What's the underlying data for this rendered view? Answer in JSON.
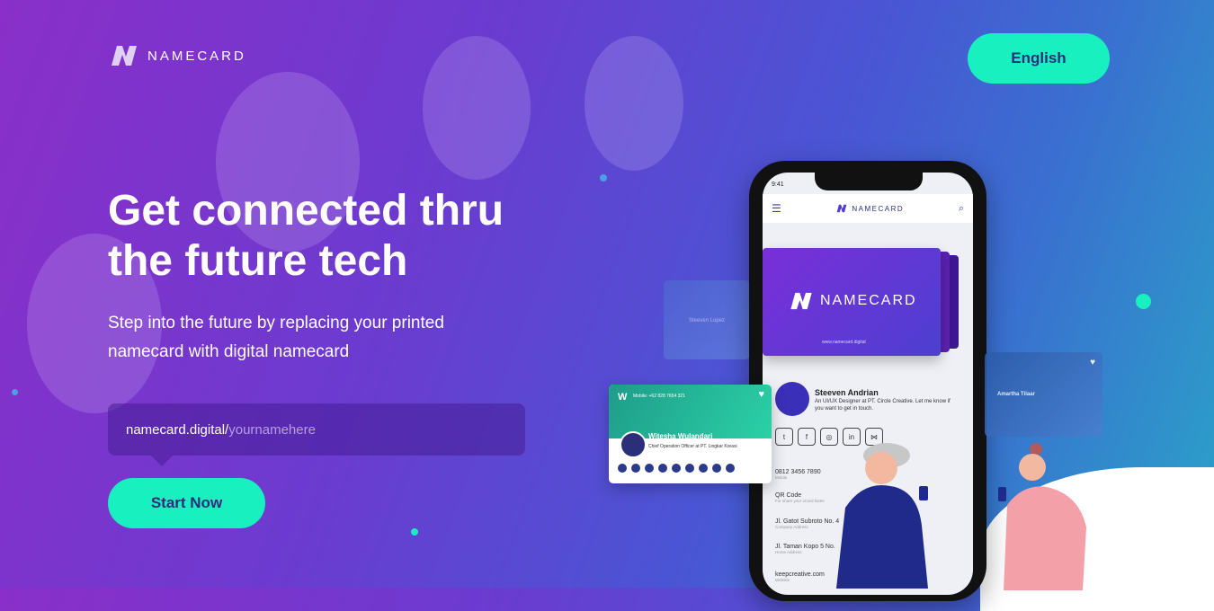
{
  "header": {
    "logo_text": "NAMECARD",
    "language_button": "English"
  },
  "hero": {
    "title": "Get connected thru the future tech",
    "subtitle": "Step into the future by replacing your printed namecard with digital namecard",
    "url_prefix": "namecard.digital/",
    "url_placeholder": "yournamehere",
    "cta": "Start Now"
  },
  "phone": {
    "time": "9:41",
    "app_logo": "NAMECARD",
    "card_brand": "NAMECARD",
    "card_url": "www.namecard.digital",
    "profile_name": "Steeven Andrian",
    "profile_desc": "An UI/UX Designer at PT. Circle Creative. Let me know if you want to get in touch.",
    "phone_number": "0812 3456 7890",
    "phone_label": "Mobile",
    "qr_label": "QR Code",
    "qr_desc": "For share your vCard faster",
    "address1": "Jl. Gatot Subroto No. 4",
    "address1_label": "Company Address",
    "address2": "Jl. Taman Kopo 5 No.",
    "address2_label": "Home Address",
    "website": "keepcreative.com",
    "website_label": "Website"
  },
  "floating_cards": {
    "green_mobile": "Mobile: +62 828 7654 321",
    "green_name": "Witesha Wulandari",
    "green_title": "Chief Operation Officer at PT. Lingkar Kreasi",
    "right_name": "Amartha Tilaar",
    "left_name": "Steeven Lopez"
  },
  "colors": {
    "accent": "#19f0c0",
    "button_text": "#2b2f7a"
  }
}
